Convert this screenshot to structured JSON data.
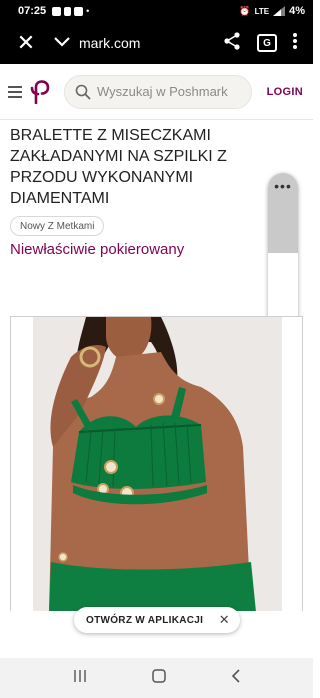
{
  "status_bar": {
    "time": "07:25",
    "network": "LTE",
    "battery": "4%"
  },
  "browser": {
    "url": "mark.com",
    "icons": [
      "close-icon",
      "chevron-down-icon",
      "share-icon",
      "translate-icon",
      "more-vert-icon"
    ]
  },
  "header": {
    "search_placeholder": "Wyszukaj w Poshmark",
    "login_label": "LOGIN",
    "brand_color": "#7F0353"
  },
  "product": {
    "title": "BRALETTE Z MISECZKAMI ZAKŁADANYMI NA SZPILKI Z PRZODU WYKONANYMI DIAMENTAMI",
    "condition_badge": "Nowy Z Metkami",
    "price_text": "Niewłaściwie pokierowany"
  },
  "app_banner": {
    "label": "OTWÓRZ W APLIKACJI"
  },
  "nav": {
    "icons": [
      "recents-icon",
      "home-icon",
      "back-icon"
    ]
  }
}
